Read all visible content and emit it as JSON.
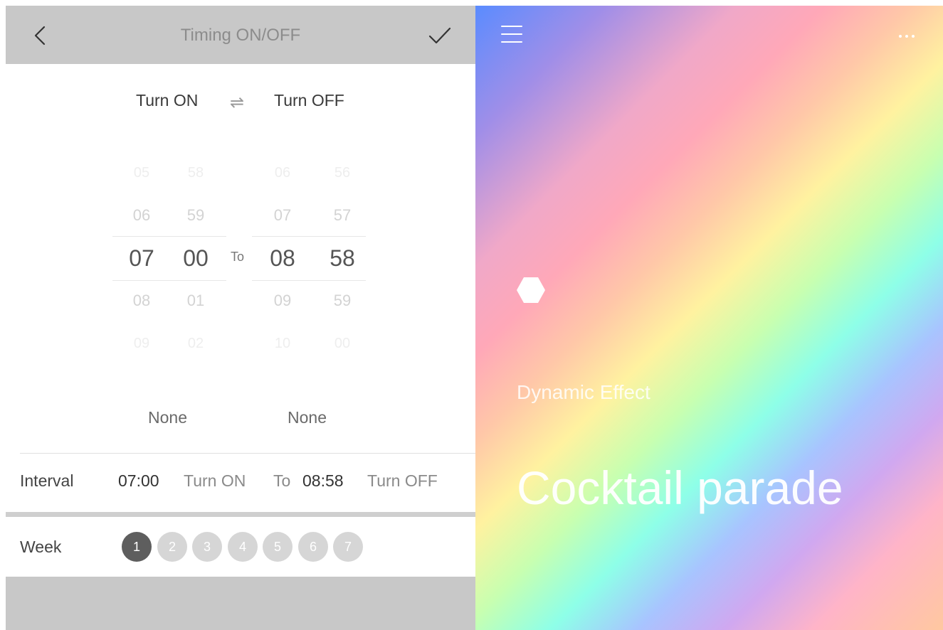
{
  "header": {
    "title": "Timing ON/OFF"
  },
  "mode": {
    "turn_on_label": "Turn ON",
    "turn_off_label": "Turn OFF"
  },
  "picker": {
    "on_hour": [
      "05",
      "06",
      "07",
      "08",
      "09"
    ],
    "on_minute": [
      "58",
      "59",
      "00",
      "01",
      "02"
    ],
    "to_label": "To",
    "off_hour": [
      "06",
      "07",
      "08",
      "09",
      "10"
    ],
    "off_minute": [
      "56",
      "57",
      "58",
      "59",
      "00"
    ]
  },
  "repeat": {
    "on_value": "None",
    "off_value": "None"
  },
  "interval": {
    "label": "Interval",
    "start_time": "07:00",
    "start_action": "Turn ON",
    "to": "To",
    "end_time": "08:58",
    "end_action": "Turn OFF"
  },
  "week": {
    "label": "Week",
    "days": [
      "1",
      "2",
      "3",
      "4",
      "5",
      "6",
      "7"
    ],
    "active_day": "1"
  },
  "effect": {
    "category": "Dynamic Effect",
    "name": "Cocktail parade"
  },
  "colors": {
    "header_bg": "#c8c8c8",
    "active_day": "#5e5e5e",
    "inactive_day": "#d6d6d6"
  }
}
